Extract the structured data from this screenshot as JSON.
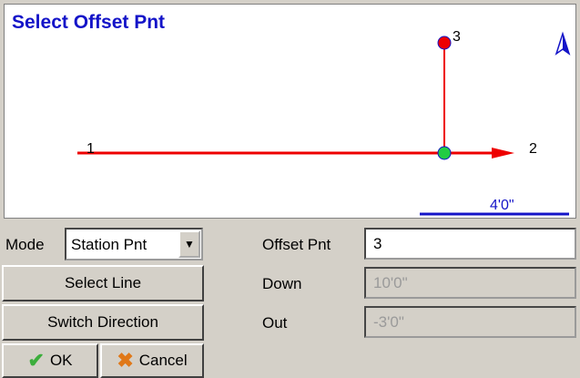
{
  "canvas": {
    "title": "Select Offset Pnt",
    "points": {
      "start": "1",
      "end": "2",
      "offset": "3"
    },
    "scale_label": "4'0\""
  },
  "mode": {
    "label": "Mode",
    "selected": "Station Pnt"
  },
  "buttons": {
    "select_line": "Select Line",
    "switch_direction": "Switch Direction",
    "ok": "OK",
    "cancel": "Cancel"
  },
  "fields": {
    "offset_pnt": {
      "label": "Offset Pnt",
      "value": "3"
    },
    "down": {
      "label": "Down",
      "value": "10'0\""
    },
    "out": {
      "label": "Out",
      "value": "-3'0\""
    }
  },
  "colors": {
    "line": "#ee0000",
    "selected_point": "#ee0000",
    "station_point": "#22cc44",
    "title": "#1414c8",
    "scale_bar": "#1414c8"
  }
}
